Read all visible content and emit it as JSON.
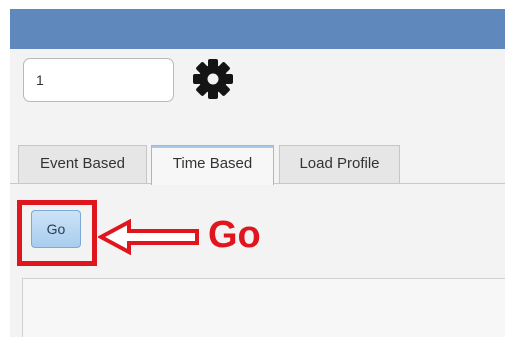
{
  "input": {
    "value": "1"
  },
  "icons": {
    "settings": "gear-icon",
    "annotation_arrow": "arrow-left-icon"
  },
  "tabs": [
    {
      "label": "Event Based",
      "active": false
    },
    {
      "label": "Time Based",
      "active": true
    },
    {
      "label": "Load Profile",
      "active": false
    }
  ],
  "go_button": {
    "label": "Go"
  },
  "annotation": {
    "text": "Go"
  },
  "colors": {
    "title_bar": "#5f89bd",
    "annotation_red": "#e0161e",
    "button_blue": "#bcd8f2",
    "background": "#f3f3f3"
  }
}
